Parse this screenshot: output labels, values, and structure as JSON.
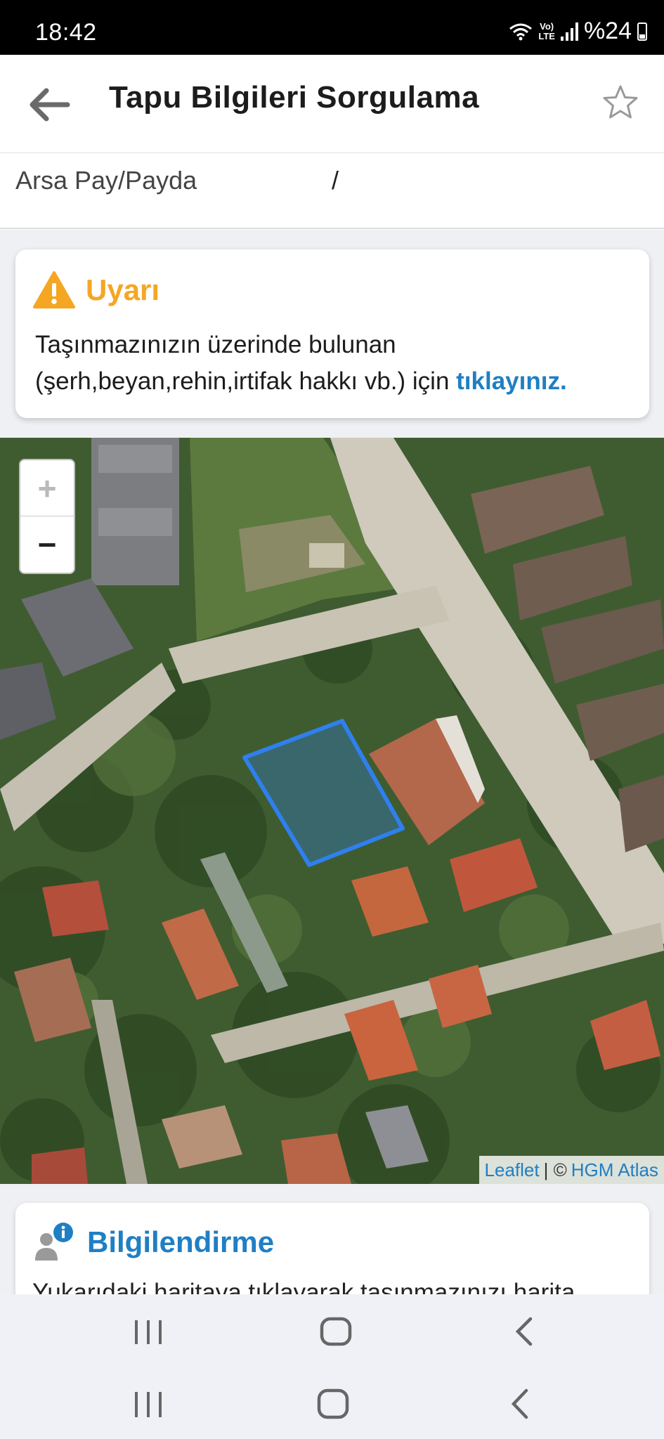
{
  "status_bar": {
    "time": "18:42",
    "network_line1": "Vo)",
    "network_line2": "LTE",
    "battery_text": "%24",
    "battery_percent": 24
  },
  "header": {
    "title": "Tapu Bilgileri Sorgulama",
    "back_icon": "arrow-left-icon",
    "favorite_icon": "star-outline-icon"
  },
  "arsa": {
    "label": "Arsa Pay/Payda",
    "value": "/"
  },
  "warning": {
    "title": "Uyarı",
    "text": "Taşınmazınızın üzerinde bulunan (şerh,beyan,rehin,irtifak hakkı vb.) için ",
    "link": "tıklayınız.",
    "icon": "warning-triangle-icon",
    "color": "#f5a623"
  },
  "map": {
    "zoom_in": "+",
    "zoom_out": "−",
    "attribution_leaflet": "Leaflet",
    "attribution_separator": " | © ",
    "attribution_provider": "HGM Atlas",
    "parcel_color": "#2f80ed"
  },
  "info": {
    "title": "Bilgilendirme",
    "text": "Yukarıdaki haritaya tıklayarak taşınmazınızı harita",
    "icon": "user-info-icon"
  },
  "colors": {
    "accent": "#1f7fc4",
    "warning": "#f5a623"
  }
}
